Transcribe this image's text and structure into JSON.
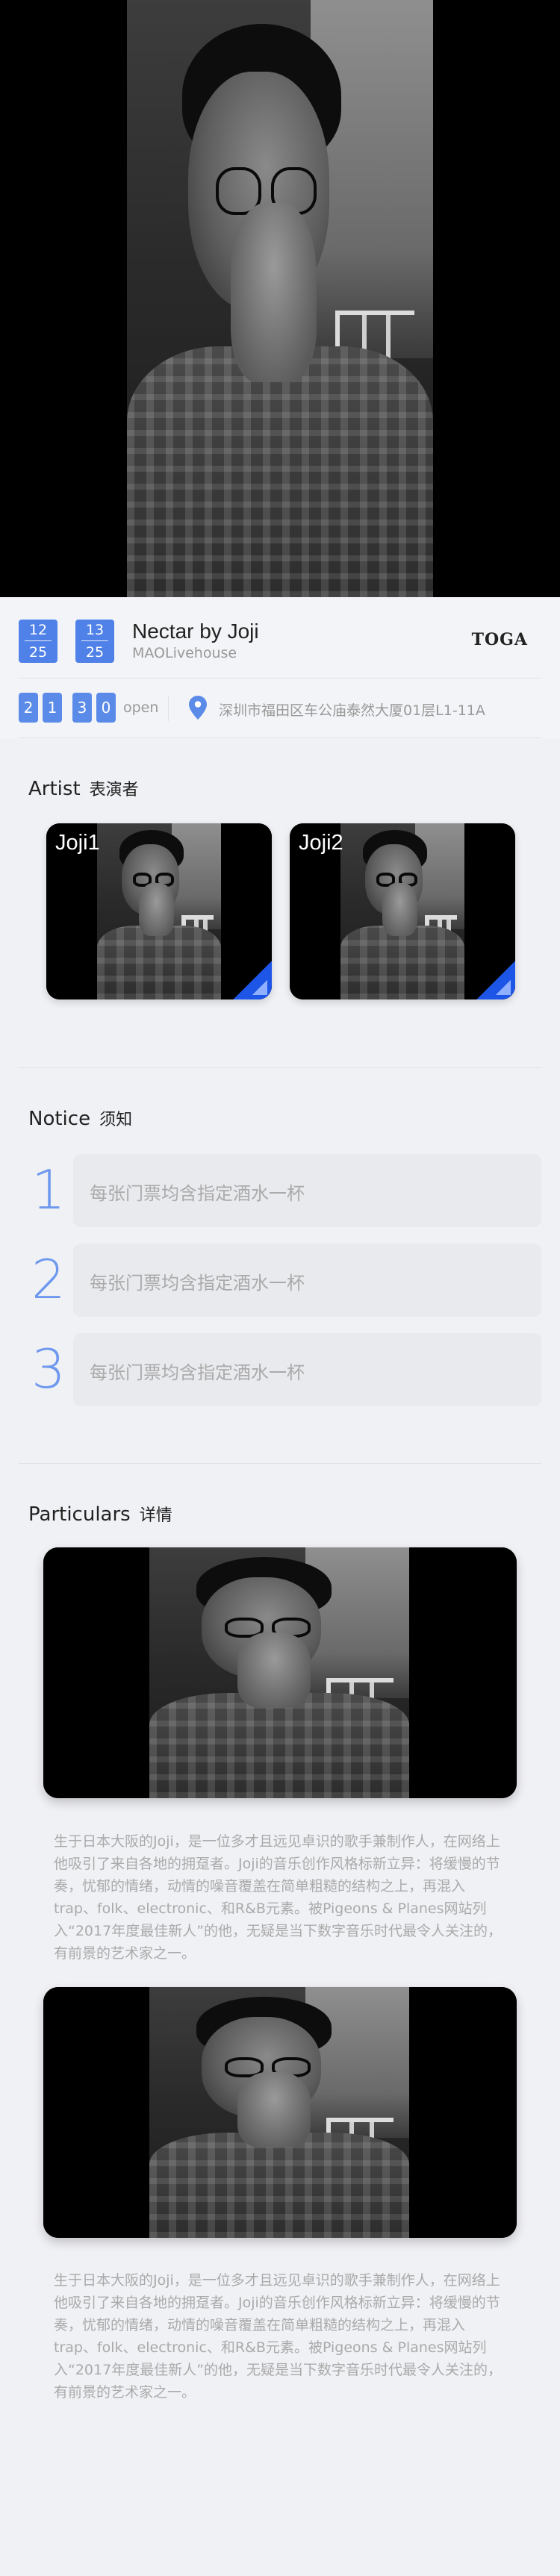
{
  "hero": {
    "image": "portrait-photo"
  },
  "event": {
    "dates": [
      {
        "top": "12",
        "bottom": "25"
      },
      {
        "top": "13",
        "bottom": "25"
      }
    ],
    "title": "Nectar by Joji",
    "venue": "MAOLivehouse",
    "brand": "TOGA",
    "time_digits": [
      "2",
      "1",
      "3",
      "0"
    ],
    "time_label": "open",
    "address": "深圳市福田区车公庙泰然大厦01层L1-11A"
  },
  "artist_section": {
    "title": "Artist",
    "title_cn": "表演者",
    "cards": [
      {
        "name": "Joji1"
      },
      {
        "name": "Joji2"
      }
    ]
  },
  "notice_section": {
    "title": "Notice",
    "title_cn": "须知",
    "items": [
      {
        "num": "1",
        "text": "每张门票均含指定酒水一杯"
      },
      {
        "num": "2",
        "text": "每张门票均含指定酒水一杯"
      },
      {
        "num": "3",
        "text": "每张门票均含指定酒水一杯"
      }
    ]
  },
  "particulars_section": {
    "title": "Particulars",
    "title_cn": "详情",
    "paragraphs": [
      "生于日本大阪的Joji，是一位多才且远见卓识的歌手兼制作人，在网络上他吸引了来自各地的拥趸者。Joji的音乐创作风格标新立异：将缓慢的节奏，忧郁的情绪，动情的噪音覆盖在简单粗糙的结构之上，再混入trap、folk、electronic、和R&B元素。被Pigeons & Planes网站列入“2017年度最佳新人”的他，无疑是当下数字音乐时代最令人关注的，有前景的艺术家之一。",
      "生于日本大阪的Joji，是一位多才且远见卓识的歌手兼制作人，在网络上他吸引了来自各地的拥趸者。Joji的音乐创作风格标新立异：将缓慢的节奏，忧郁的情绪，动情的噪音覆盖在简单粗糙的结构之上，再混入trap、folk、electronic、和R&B元素。被Pigeons & Planes网站列入“2017年度最佳新人”的他，无疑是当下数字音乐时代最令人关注的，有前景的艺术家之一。"
    ]
  },
  "colors": {
    "accent": "#4f81e8",
    "background": "#f0f1f5",
    "notice_box": "#e9eaee",
    "muted_text": "#aaaaaa"
  }
}
